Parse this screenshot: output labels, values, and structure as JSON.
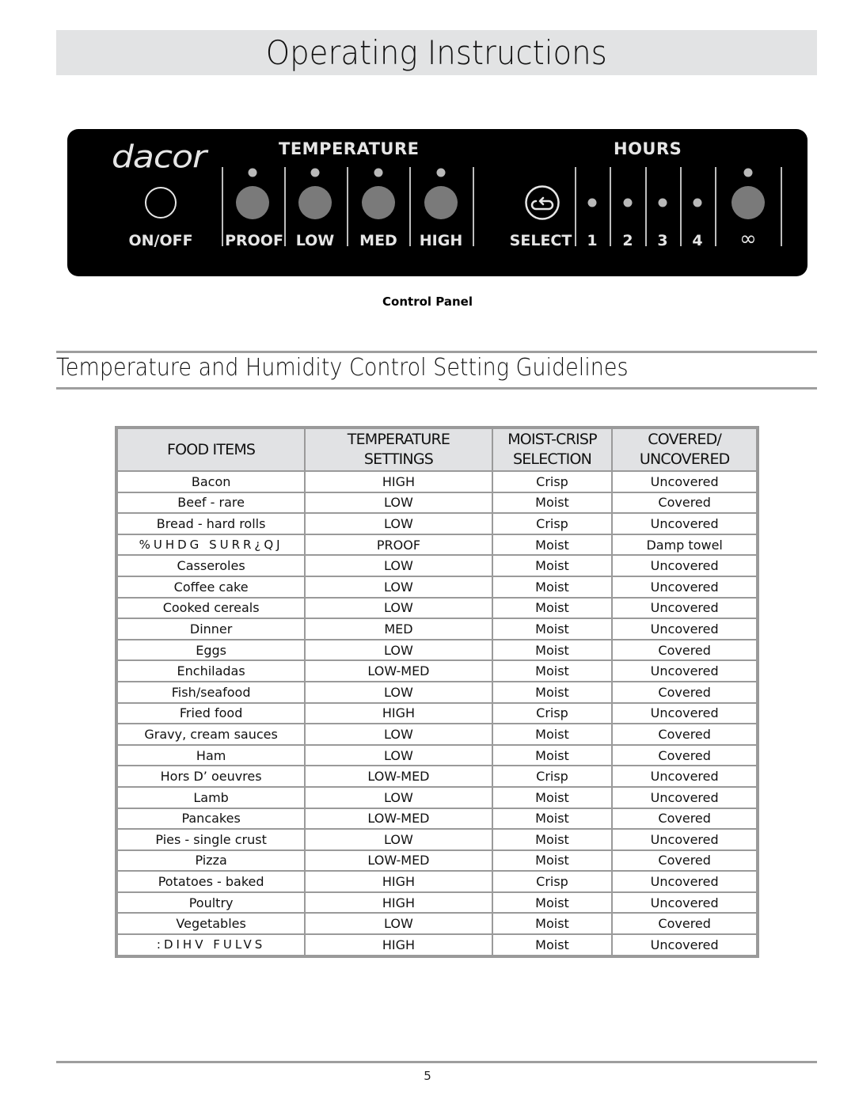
{
  "page": {
    "title": "Operating Instructions",
    "page_number": "5"
  },
  "control_panel": {
    "brand": "dacor",
    "temperature_header": "TEMPERATURE",
    "hours_header": "HOURS",
    "caption": "Control Panel",
    "buttons": {
      "on_off": "ON/OFF",
      "proof": "PROOF",
      "low": "LOW",
      "med": "MED",
      "high": "HIGH",
      "select": "SELECT",
      "h1": "1",
      "h2": "2",
      "h3": "3",
      "h4": "4",
      "infinite": "∞"
    }
  },
  "section": {
    "title": "Temperature and Humidity Control Setting Guidelines"
  },
  "table": {
    "headers": [
      {
        "line1": "FOOD ITEMS",
        "line2": ""
      },
      {
        "line1": "TEMPERATURE",
        "line2": "SETTINGS"
      },
      {
        "line1": "MOIST-CRISP",
        "line2": "SELECTION"
      },
      {
        "line1": "COVERED/",
        "line2": "UNCOVERED"
      }
    ],
    "rows": [
      [
        "Bacon",
        "HIGH",
        "Crisp",
        "Uncovered"
      ],
      [
        "Beef - rare",
        "LOW",
        "Moist",
        "Covered"
      ],
      [
        "Bread - hard rolls",
        "LOW",
        "Crisp",
        "Uncovered"
      ],
      [
        "%UHDG  SURR¿QJ",
        "PROOF",
        "Moist",
        "Damp towel"
      ],
      [
        "Casseroles",
        "LOW",
        "Moist",
        "Uncovered"
      ],
      [
        "Coffee cake",
        "LOW",
        "Moist",
        "Uncovered"
      ],
      [
        "Cooked cereals",
        "LOW",
        "Moist",
        "Uncovered"
      ],
      [
        "Dinner",
        "MED",
        "Moist",
        "Uncovered"
      ],
      [
        "Eggs",
        "LOW",
        "Moist",
        "Covered"
      ],
      [
        "Enchiladas",
        "LOW-MED",
        "Moist",
        "Uncovered"
      ],
      [
        "Fish/seafood",
        "LOW",
        "Moist",
        "Covered"
      ],
      [
        "Fried food",
        "HIGH",
        "Crisp",
        "Uncovered"
      ],
      [
        "Gravy, cream sauces",
        "LOW",
        "Moist",
        "Covered"
      ],
      [
        "Ham",
        "LOW",
        "Moist",
        "Covered"
      ],
      [
        "Hors D’ oeuvres",
        "LOW-MED",
        "Crisp",
        "Uncovered"
      ],
      [
        "Lamb",
        "LOW",
        "Moist",
        "Uncovered"
      ],
      [
        "Pancakes",
        "LOW-MED",
        "Moist",
        "Covered"
      ],
      [
        "Pies - single crust",
        "LOW",
        "Moist",
        "Uncovered"
      ],
      [
        "Pizza",
        "LOW-MED",
        "Moist",
        "Covered"
      ],
      [
        "Potatoes - baked",
        "HIGH",
        "Crisp",
        "Uncovered"
      ],
      [
        "Poultry",
        "HIGH",
        "Moist",
        "Uncovered"
      ],
      [
        "Vegetables",
        "LOW",
        "Moist",
        "Covered"
      ],
      [
        ":DIHV  FULVS",
        "HIGH",
        "Moist",
        "Uncovered"
      ]
    ],
    "garbled_rows": [
      3,
      22
    ]
  }
}
